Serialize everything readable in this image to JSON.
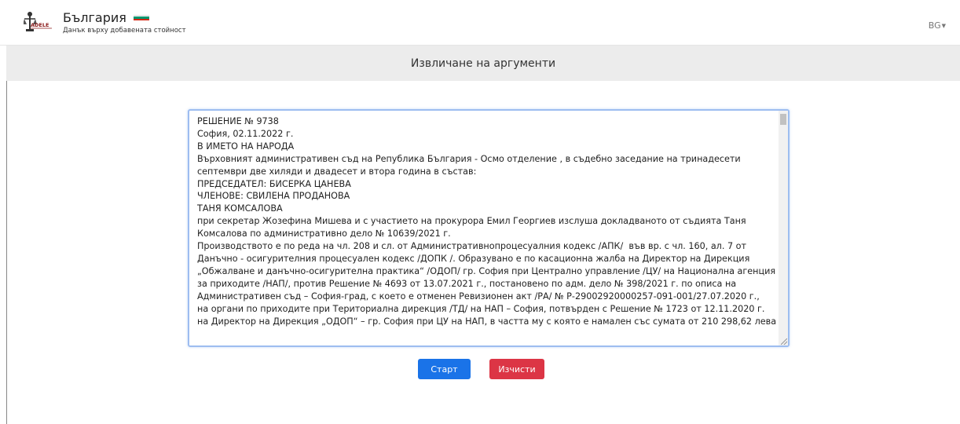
{
  "brand": {
    "title": "България",
    "subtitle": "Данък върху добавената стойност",
    "logo_text": "ADELE",
    "flag_colors": [
      "#ffffff",
      "#00966e",
      "#d62612"
    ]
  },
  "language": {
    "label": "BG"
  },
  "page": {
    "title": "Извличане на аргументи"
  },
  "document_text": "РЕШЕНИЕ № 9738\nСофия, 02.11.2022 г.\nВ ИМЕТО НА НАРОДА\nВърховният административен съд на Република България - Осмо отделение , в съдебно заседание на тринадесети\nсептември две хиляди и двадесет и втора година в състав:\nПРЕДСЕДАТЕЛ: БИСЕРКА ЦАНЕВА\nЧЛЕНОВЕ: СВИЛЕНА ПРОДАНОВА\nТАНЯ КОМСАЛОВА\nпри секретар Жозефина Мишева и с участието на прокурора Емил Георгиев изслуша докладваното от съдията Таня\nКомсалова по административно дело № 10639/2021 г.\nПроизводството е по реда на чл. 208 и сл. от Административнопроцесуалния кодекс /АПК/  във вр. с чл. 160, ал. 7 от\nДанъчно - осигурителния процесуален кодекс /ДОПК /. Образувано е по касационна жалба на Директор на Дирекция\n„Обжалване и данъчно-осигурителна практика“ /ОДОП/ гр. София при Централно управление /ЦУ/ на Национална агенция\nза приходите /НАП/, против Решение № 4693 от 13.07.2021 г., постановено по адм. дело № 398/2021 г. по описа на\nАдминистративен съд – София-град, с което е отменен Ревизионен акт /РА/ № Р-29002920000257-091-001/27.07.2020 г.,\nна органи по приходите при Териториална дирекция /ТД/ на НАП – София, потвърден с Решение № 1723 от 12.11.2020 г.\nна Директор на Дирекция „ОДОП“ – гр. София при ЦУ на НАП, в частта му с която е намален със сумата от 210 298,62 лева",
  "buttons": {
    "start": "Старт",
    "clear": "Изчисти"
  },
  "colors": {
    "start_button": "#1a73e8",
    "clear_button": "#dc3545",
    "header_band": "#ececec"
  }
}
